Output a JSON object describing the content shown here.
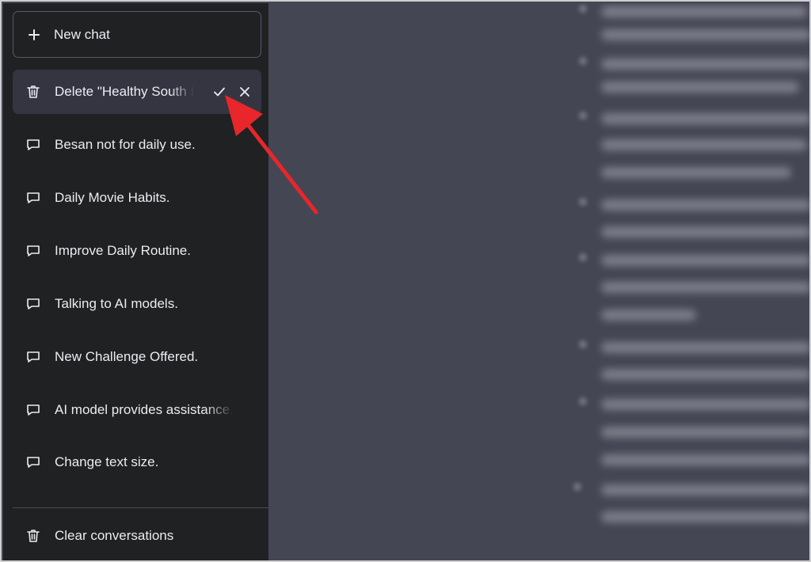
{
  "sidebar": {
    "new_chat_label": "New chat",
    "editing_item": {
      "label": "Delete \"Healthy South I",
      "icon": "trash-icon",
      "confirm_icon": "check-icon",
      "cancel_icon": "close-icon"
    },
    "conversations": [
      {
        "label": "Besan not for daily use.",
        "icon": "chat-bubble-icon"
      },
      {
        "label": "Daily Movie Habits.",
        "icon": "chat-bubble-icon"
      },
      {
        "label": "Improve Daily Routine.",
        "icon": "chat-bubble-icon"
      },
      {
        "label": "Talking to AI models.",
        "icon": "chat-bubble-icon"
      },
      {
        "label": "New Challenge Offered.",
        "icon": "chat-bubble-icon"
      },
      {
        "label": "AI model provides assistance.",
        "icon": "chat-bubble-icon"
      },
      {
        "label": "Change text size.",
        "icon": "chat-bubble-icon"
      }
    ],
    "clear_label": "Clear conversations"
  },
  "colors": {
    "sidebar_bg": "#202123",
    "active_item_bg": "#343541",
    "main_bg": "#444654",
    "text": "#ececf1",
    "annotation_arrow": "#e8262b"
  }
}
